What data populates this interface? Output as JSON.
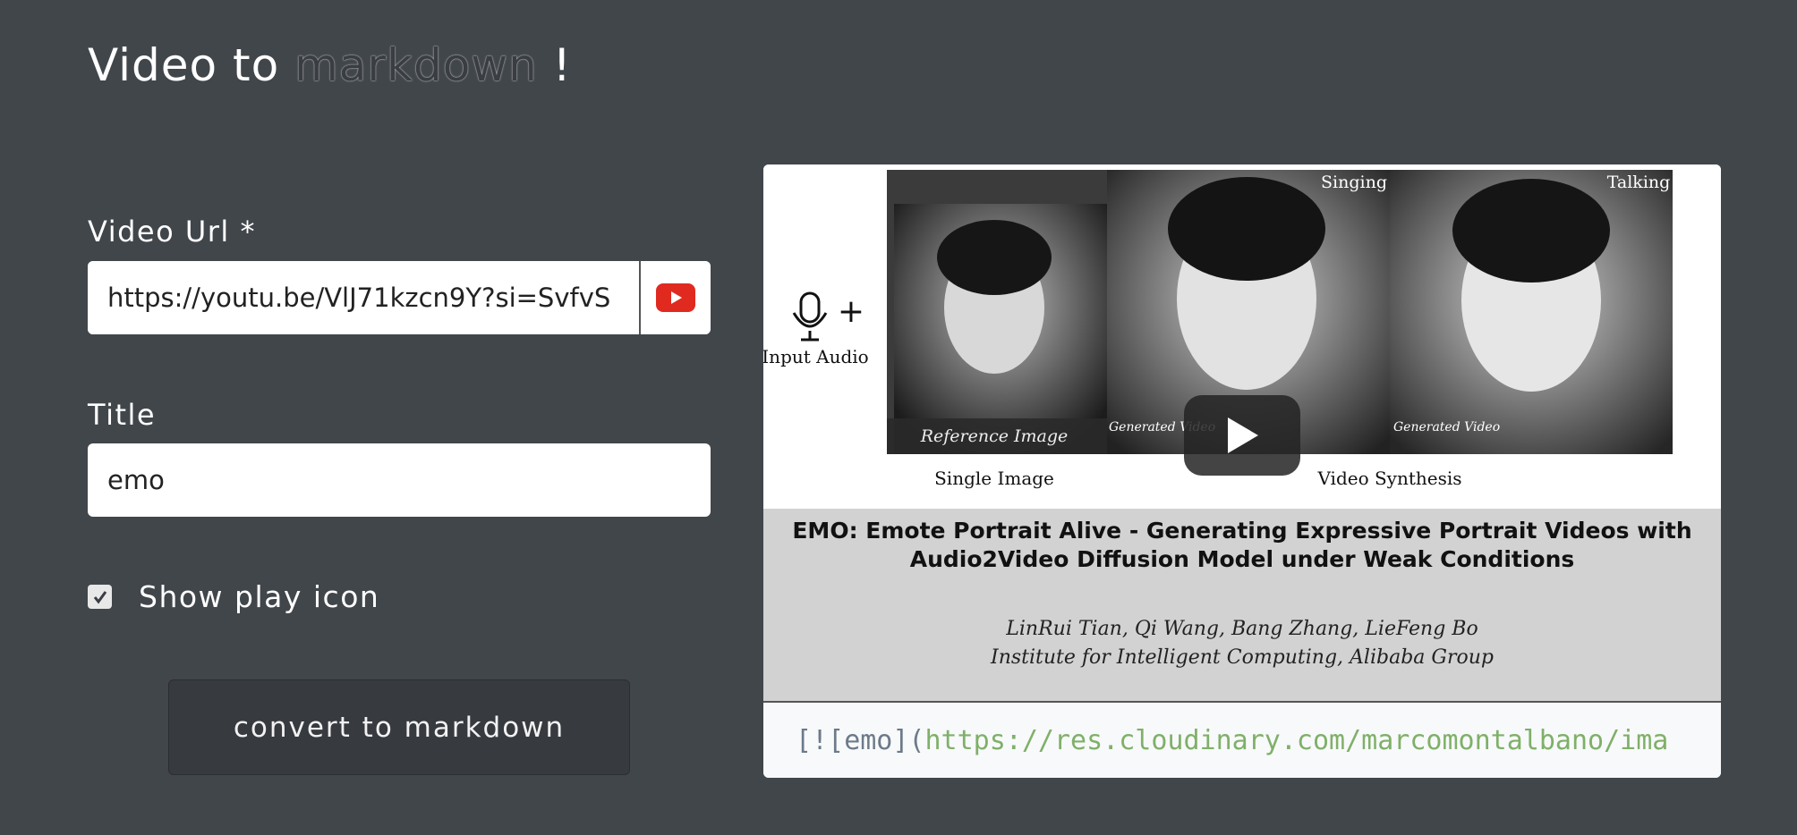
{
  "app": {
    "title_prefix": "Video to",
    "title_accent": "markdown",
    "title_suffix": "!"
  },
  "form": {
    "video_url_label": "Video Url *",
    "video_url_value": "https://youtu.be/VlJ71kzcn9Y?si=SvfvS",
    "title_label": "Title",
    "title_value": "emo",
    "show_play_icon_label": "Show play icon",
    "show_play_icon_checked": true,
    "convert_button_label": "convert to markdown"
  },
  "preview": {
    "thumbnail": {
      "tag_input_audio": "Input Audio",
      "tag_reference_image": "Reference Image",
      "tag_singing": "Singing",
      "tag_talking": "Talking",
      "tag_generated_1": "Generated Video",
      "tag_generated_2": "Generated Video",
      "caption_single_image": "Single Image",
      "caption_video_synthesis": "Video Synthesis",
      "paper_title_line1": "EMO: Emote Portrait Alive - Generating Expressive Portrait Videos with",
      "paper_title_line2": "Audio2Video Diffusion Model under Weak Conditions",
      "authors": "LinRui Tian, Qi Wang, Bang Zhang, LieFeng Bo",
      "affiliation": "Institute for Intelligent Computing, Alibaba Group"
    },
    "markdown_punct_open": "[![",
    "markdown_alt": "emo",
    "markdown_punct_mid": "](",
    "markdown_url": "https://res.cloudinary.com/marcomontalbano/ima"
  },
  "colors": {
    "background": "#41464b",
    "youtube_red": "#e02a20",
    "code_url": "#7fb069"
  },
  "icons": [
    "youtube-icon",
    "checkmark-icon",
    "play-icon",
    "microphone-icon"
  ]
}
